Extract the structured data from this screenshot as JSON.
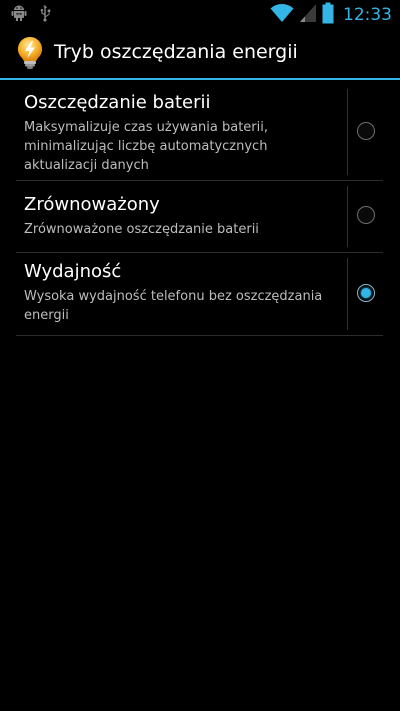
{
  "status_bar": {
    "time": "12:33",
    "left_icons": [
      "android-debug-icon",
      "usb-icon"
    ],
    "right_icons": [
      "wifi-icon",
      "signal-icon",
      "battery-icon"
    ],
    "accent_color": "#33b5e5"
  },
  "action_bar": {
    "title": "Tryb oszczędzania energii",
    "icon": "lightbulb-icon"
  },
  "options": [
    {
      "title": "Oszczędzanie baterii",
      "summary": "Maksymalizuje czas używania baterii, minimalizując liczbę automatycznych aktualizacji danych",
      "selected": false
    },
    {
      "title": "Zrównoważony",
      "summary": "Zrównoważone oszczędzanie baterii",
      "selected": false
    },
    {
      "title": "Wydajność",
      "summary": "Wysoka wydajność telefonu bez oszczędzania energii",
      "selected": true
    }
  ]
}
